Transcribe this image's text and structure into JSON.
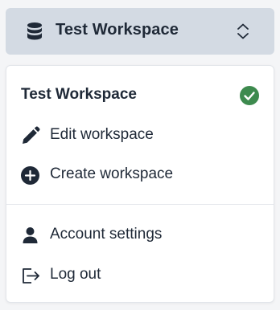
{
  "switcher": {
    "title": "Test Workspace",
    "icon": "database-icon",
    "toggle_icon": "chevron-up-down-icon"
  },
  "menu": {
    "current_workspace": {
      "label": "Test Workspace",
      "status_icon": "check-circle-icon",
      "status_color": "#3d8a4e"
    },
    "items": [
      {
        "label": "Edit workspace",
        "icon": "pencil-icon"
      },
      {
        "label": "Create workspace",
        "icon": "plus-circle-icon"
      }
    ],
    "account_items": [
      {
        "label": "Account settings",
        "icon": "user-icon"
      },
      {
        "label": "Log out",
        "icon": "logout-icon"
      }
    ]
  },
  "colors": {
    "switcher_bg": "#d3dae3",
    "text": "#1f2937",
    "check": "#3d8a4e"
  }
}
